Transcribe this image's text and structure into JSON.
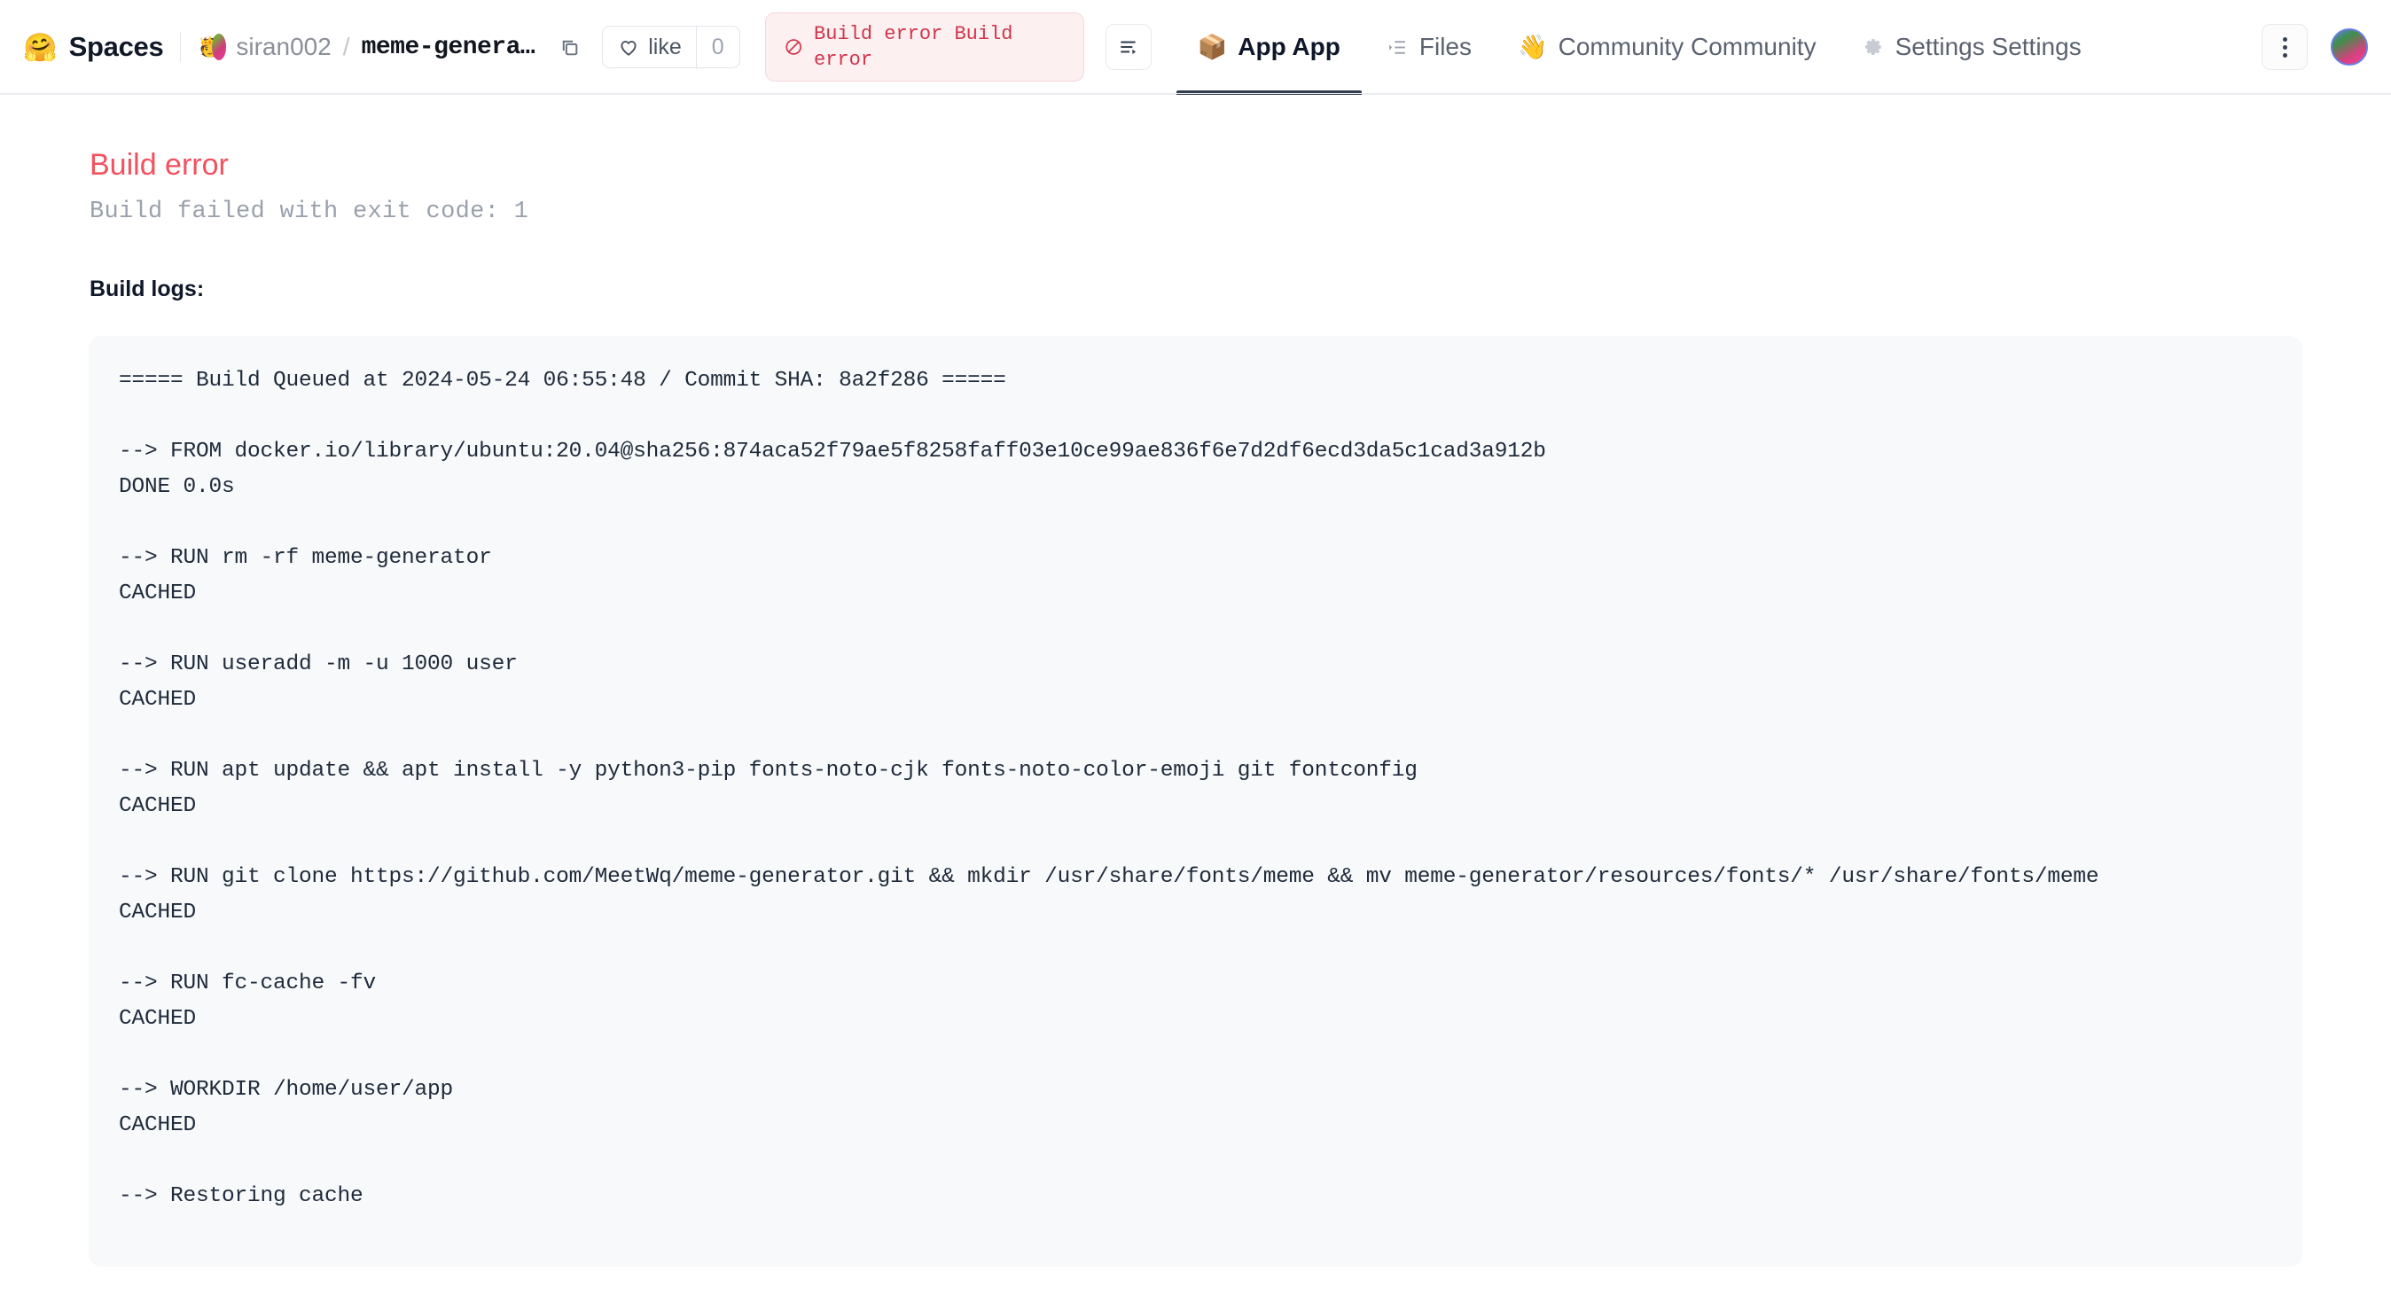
{
  "header": {
    "brand_emoji": "🤗",
    "brand_label": "Spaces",
    "repo": {
      "owner_emoji": "🫅",
      "owner": "siran002",
      "separator": "/",
      "name": "meme-genera…",
      "copy_icon": "copy-icon"
    },
    "like": {
      "label": "like",
      "count": "0",
      "icon": "heart-icon"
    },
    "status_badge": {
      "icon": "no-entry-icon",
      "text": "Build error Build error"
    },
    "logs_button_icon": "logs-icon",
    "tabs": [
      {
        "icon": "cube-emoji",
        "emoji": "📦",
        "label": "App App",
        "active": true
      },
      {
        "icon": "files-icon",
        "emoji": "",
        "label": "Files",
        "active": false
      },
      {
        "icon": "wave-emoji",
        "emoji": "👋",
        "label": "Community Community",
        "active": false
      },
      {
        "icon": "gear-emoji",
        "emoji": "⚙",
        "label": "Settings Settings",
        "active": false
      }
    ],
    "kebab_icon": "kebab-menu-icon",
    "user_avatar": "user-avatar"
  },
  "main": {
    "error_title": "Build error",
    "error_subtitle": "Build failed with exit code: 1",
    "logs_label": "Build logs:",
    "log_lines": [
      "===== Build Queued at 2024-05-24 06:55:48 / Commit SHA: 8a2f286 =====",
      "",
      "--> FROM docker.io/library/ubuntu:20.04@sha256:874aca52f79ae5f8258faff03e10ce99ae836f6e7d2df6ecd3da5c1cad3a912b",
      "DONE 0.0s",
      "",
      "--> RUN rm -rf meme-generator",
      "CACHED",
      "",
      "--> RUN useradd -m -u 1000 user",
      "CACHED",
      "",
      "--> RUN apt update && apt install -y python3-pip fonts-noto-cjk fonts-noto-color-emoji git fontconfig",
      "CACHED",
      "",
      "--> RUN git clone https://github.com/MeetWq/meme-generator.git && mkdir /usr/share/fonts/meme && mv meme-generator/resources/fonts/* /usr/share/fonts/meme",
      "CACHED",
      "",
      "--> RUN fc-cache -fv",
      "CACHED",
      "",
      "--> WORKDIR /home/user/app",
      "CACHED",
      "",
      "--> Restoring cache"
    ]
  },
  "colors": {
    "error_red": "#f2515f",
    "badge_red": "#d0344a",
    "badge_bg": "#fdf0f1",
    "log_bg": "#f7f9fa",
    "log_text": "#1f2a3a",
    "active_tab_underline": "#323d4e"
  }
}
